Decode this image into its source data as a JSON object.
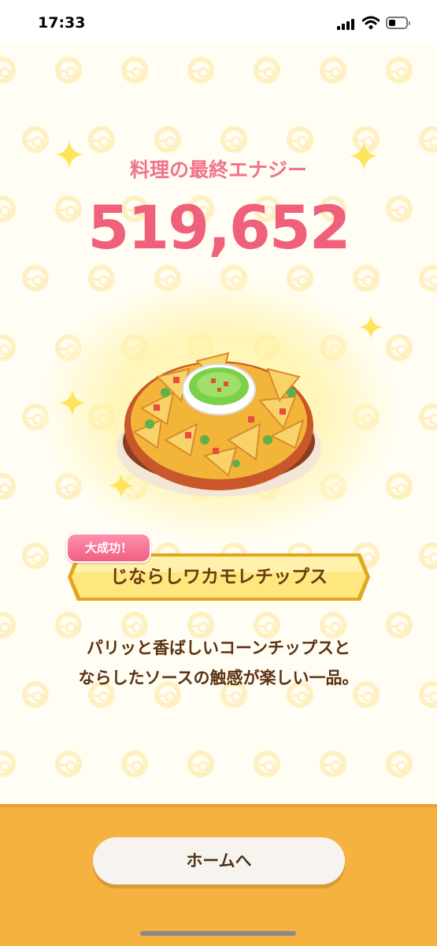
{
  "status_bar": {
    "time": "17:33",
    "battery_level": 0.4,
    "icons": [
      "signal-icon",
      "wifi-icon",
      "battery-icon"
    ]
  },
  "result": {
    "energy_label": "料理の最終エナジー",
    "energy_value": "519,652",
    "badge": "大成功！",
    "dish_name": "じならしワカモレチップス",
    "description": [
      "パリッと香ばしいコーンチップスと",
      "ならしたソースの触感が楽しい一品。"
    ]
  },
  "footer": {
    "home_button": "ホームへ"
  },
  "colors": {
    "energy": "#f0607a",
    "footer": "#f5b23f",
    "badge": "#f0607f",
    "nameplate": "#ffe07a"
  }
}
